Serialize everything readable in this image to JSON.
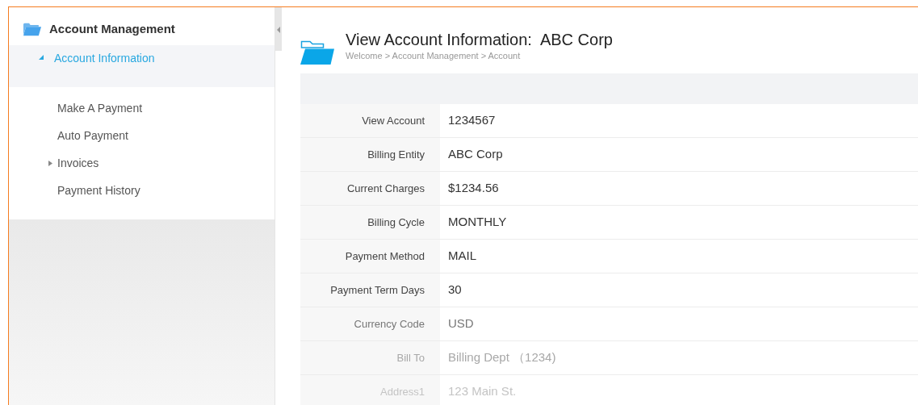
{
  "sidebar": {
    "title": "Account Management",
    "items": [
      {
        "label": "Account Information",
        "selected": true,
        "expanded": true,
        "children": [
          {
            "label": "Make A Payment",
            "selected": false
          },
          {
            "label": "Auto Payment",
            "selected": false
          },
          {
            "label": "Invoices",
            "selected": false,
            "expanded": false
          },
          {
            "label": "Payment History",
            "selected": false
          }
        ]
      }
    ]
  },
  "page": {
    "title": "View Account Information:",
    "subject": "ABC Corp",
    "breadcrumb": "Welcome > Account Management > Account"
  },
  "details": [
    {
      "label": "View Account",
      "value": "1234567"
    },
    {
      "label": "Billing Entity",
      "value": "ABC Corp"
    },
    {
      "label": "Current Charges",
      "value": "$1234.56"
    },
    {
      "label": "Billing Cycle",
      "value": "MONTHLY"
    },
    {
      "label": "Payment Method",
      "value": "MAIL"
    },
    {
      "label": "Payment Term Days",
      "value": "30"
    },
    {
      "label": "Currency Code",
      "value": "USD"
    },
    {
      "label": "Bill To",
      "value": "Billing Dept （1234)"
    },
    {
      "label": "Address1",
      "value": "123 Main St."
    }
  ]
}
